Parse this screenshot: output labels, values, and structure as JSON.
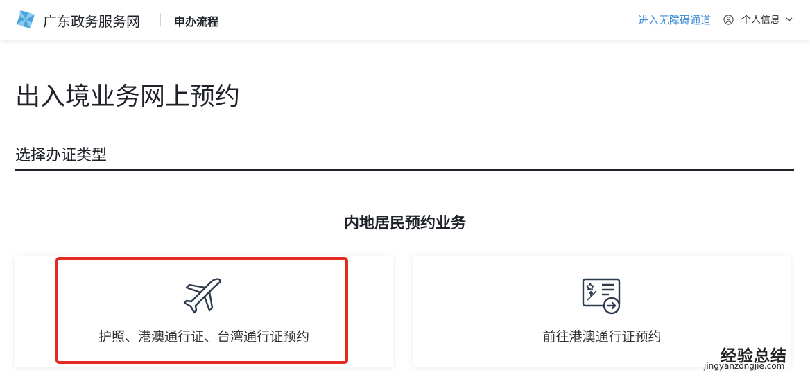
{
  "header": {
    "site_name": "广东政务服务网",
    "flow_title": "申办流程",
    "accessible_link": "进入无障碍通道",
    "user_label": "个人信息",
    "logo_icon": "pinwheel-logo-icon",
    "user_icon": "user-circle-icon",
    "dropdown_icon": "chevron-down-icon"
  },
  "main": {
    "page_title": "出入境业务网上预约",
    "section_label": "选择办证类型",
    "group_title": "内地居民预约业务",
    "cards": [
      {
        "label": "护照、港澳通行证、台湾通行证预约",
        "icon": "airplane-icon"
      },
      {
        "label": "前往港澳通行证预约",
        "icon": "permit-card-icon"
      }
    ]
  },
  "watermark": {
    "main": "经验总结",
    "sub": "jingyanzongjie.com"
  },
  "colors": {
    "accent_link": "#3f8fd8",
    "logo": "#49a6dc",
    "highlight": "#e22a22",
    "text": "#1f2329"
  }
}
